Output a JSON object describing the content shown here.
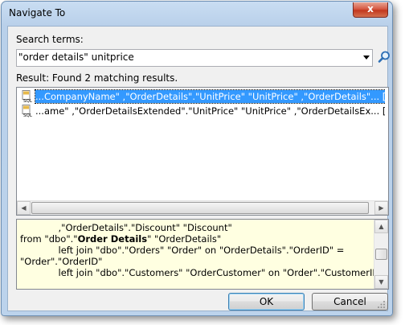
{
  "window": {
    "title": "Navigate To",
    "close_glyph": "x"
  },
  "search": {
    "label": "Search terms:",
    "value": "\"order details\" unitprice",
    "search_icon": "magnifier-icon",
    "dropdown_icon": "chevron-down-icon"
  },
  "results": {
    "summary": "Result: Found 2 matching results.",
    "items": [
      {
        "icon": "sql-file-icon",
        "text": "...CompanyName\" ,\"OrderDetails\".\"UnitPrice\" \"UnitPrice\" ,\"OrderDetails\"... [\"Text\" of d",
        "selected": true
      },
      {
        "icon": "sql-file-icon",
        "text": "...ame\" ,\"OrderDetailsExtended\".\"UnitPrice\" \"UnitPrice\" ,\"OrderDetailsEx... [\"Text\" of d",
        "selected": false
      }
    ]
  },
  "preview": {
    "line1": "             ,\"OrderDetails\".\"Discount\" \"Discount\"",
    "line2_pre": "from \"dbo\".\"",
    "line2_bold": "Order Details",
    "line2_post": "\" \"OrderDetails\"",
    "line3": "             left join \"dbo\".\"Orders\" \"Order\" on \"OrderDetails\".\"OrderID\" =",
    "line4": "\"Order\".\"OrderID\"",
    "line5": "             left join \"dbo\".\"Customers\" \"OrderCustomer\" on \"Order\".\"CustomerID\" ="
  },
  "buttons": {
    "ok": "OK",
    "cancel": "Cancel"
  },
  "colors": {
    "selection": "#3399ff",
    "preview_background": "#ffffe1",
    "close_button": "#c2381f"
  }
}
